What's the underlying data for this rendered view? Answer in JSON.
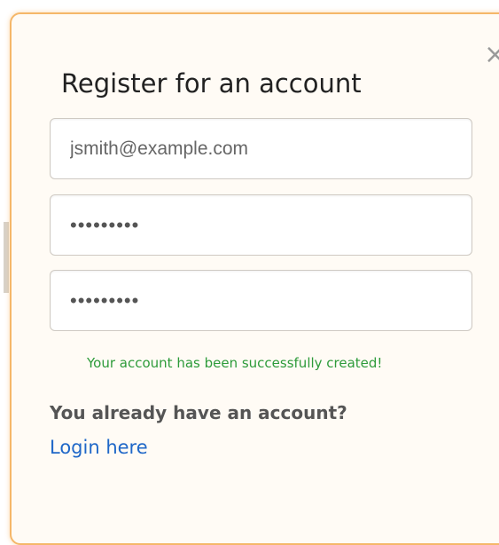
{
  "modal": {
    "title": "Register for an account",
    "close_label": "×",
    "close_icon": "close-icon"
  },
  "form": {
    "email_value": "jsmith@example.com",
    "password_value": "•••••••••",
    "confirm_value": "•••••••••"
  },
  "status": {
    "success_message": "Your account has been successfully created!",
    "success_color": "#2d9b3a"
  },
  "footer": {
    "question": "You already have an account?",
    "login_label": "Login here",
    "link_color": "#1f67c8"
  },
  "colors": {
    "modal_border": "#f5b769",
    "modal_background": "#fffbf5"
  }
}
